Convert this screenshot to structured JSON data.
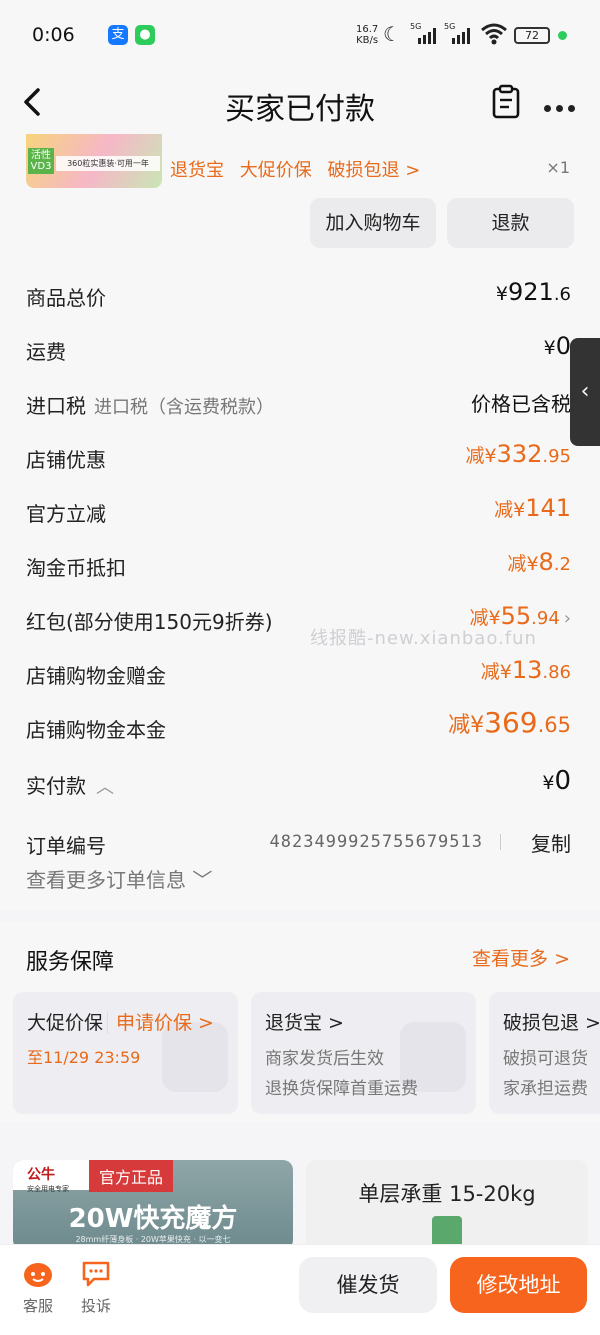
{
  "status_bar": {
    "time": "0:06",
    "net_speed_value": "16.7",
    "net_speed_unit": "KB/s",
    "sim1": "5G",
    "sim2": "5G",
    "battery": "72",
    "icons": [
      "alipay-icon",
      "wechat-icon",
      "moon-icon",
      "signal-icon",
      "wifi-icon",
      "battery-icon"
    ]
  },
  "navbar": {
    "title": "买家已付款"
  },
  "product": {
    "thumb_label": "活性VD3",
    "thumb_caption": "360粒实惠装·可用一年",
    "tags": [
      "退货宝",
      "大促价保",
      "破损包退 >"
    ],
    "quantity": "×1"
  },
  "actions": {
    "add_to_cart": "加入购物车",
    "refund": "退款"
  },
  "price_rows": [
    {
      "label": "商品总价",
      "currency": "¥",
      "main": "921",
      "dec": ".6"
    },
    {
      "label": "运费",
      "currency": "¥",
      "main": "0",
      "dec": ""
    },
    {
      "label": "进口税",
      "sub": "进口税（含运费税款）",
      "text": "价格已含税"
    },
    {
      "label": "店铺优惠",
      "prefix": "减",
      "currency": "¥",
      "main": "332",
      "dec": ".95"
    },
    {
      "label": "官方立减",
      "prefix": "减",
      "currency": "¥",
      "main": "141",
      "dec": ""
    },
    {
      "label": "淘金币抵扣",
      "prefix": "减",
      "currency": "¥",
      "main": "8",
      "dec": ".2"
    },
    {
      "label": "红包(部分使用150元9折券)",
      "prefix": "减",
      "currency": "¥",
      "main": "55",
      "dec": ".94"
    },
    {
      "label": "店铺购物金赠金",
      "prefix": "减",
      "currency": "¥",
      "main": "13",
      "dec": ".86"
    },
    {
      "label": "店铺购物金本金",
      "prefix": "减",
      "currency": "¥",
      "main": "369",
      "dec": ".65"
    },
    {
      "label": "实付款",
      "currency": "¥",
      "main": "0",
      "dec": ""
    }
  ],
  "order": {
    "label": "订单编号",
    "number": "4823499925755679513",
    "copy": "复制",
    "more_info": "查看更多订单信息"
  },
  "watermark": "线报酷-new.xianbao.fun",
  "service": {
    "title": "服务保障",
    "more": "查看更多 >",
    "cards": [
      {
        "title": "大促价保",
        "apply": "申请价保 >",
        "line1": "至11/29 23:59",
        "line2": ""
      },
      {
        "title": "退货宝 >",
        "line1": "商家发货后生效",
        "line2": "退换货保障首重运费"
      },
      {
        "title": "破损包退 >",
        "line1": "破损可退货",
        "line2": "家承担运费"
      }
    ]
  },
  "recommendations": [
    {
      "brand": "公牛",
      "brand_sub": "安全用电专家",
      "badge": "官方正品",
      "headline": "20W快充魔方",
      "tagline": "28mm纤薄身板 · 20W苹果快充 · 以一变七"
    },
    {
      "headline": "单层承重 15-20kg"
    }
  ],
  "bottom_bar": {
    "customer_service": "客服",
    "complain": "投诉",
    "urge_ship": "催发货",
    "change_address": "修改地址"
  },
  "colors": {
    "accent": "#e86a1a",
    "primary_button": "#f7641d",
    "background": "#f5f5f7"
  }
}
